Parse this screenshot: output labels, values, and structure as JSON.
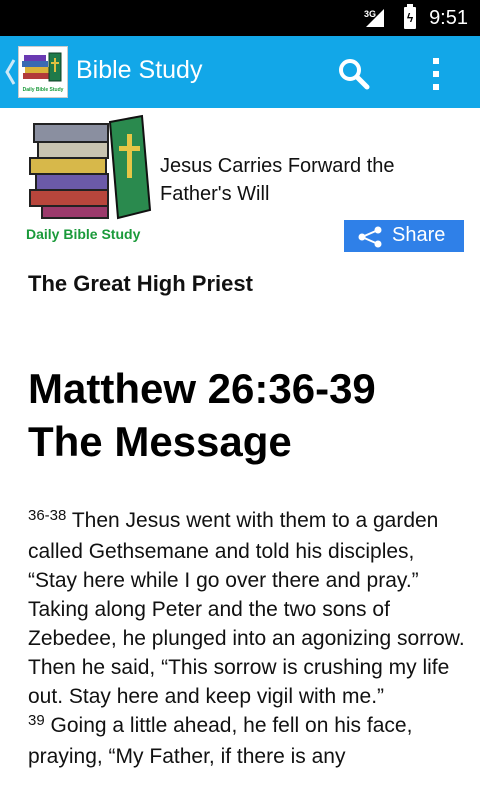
{
  "status_bar": {
    "network": "3G",
    "time": "9:51"
  },
  "app_bar": {
    "title": "Bible Study",
    "logo_text": "Daily Bible Study",
    "icons": [
      "up-chevron-icon",
      "search-icon",
      "overflow-menu-icon"
    ]
  },
  "devotion": {
    "title_line1": "Jesus Carries Forward the",
    "title_line2": "Father's Will",
    "site_name": "Daily Bible Study",
    "share_label": "Share",
    "subtitle": "The Great High Priest",
    "scripture_line1": "Matthew 26:36-39",
    "scripture_line2": "The Message",
    "verses": [
      {
        "number": "36-38",
        "text": " Then Jesus went with them to a garden called Gethsemane and told his disciples, “Stay here while I go over there and pray.” Taking along Peter and the two sons of Zebedee, he plunged into an agonizing sorrow. Then he said, “This sorrow is crushing my life out. Stay here and keep vigil with me.”"
      },
      {
        "number": "39",
        "text": " Going a little ahead, he fell on his face, praying, “My Father, if there is any"
      }
    ]
  },
  "colors": {
    "app_bar": "#12a7e8",
    "share_button": "#2f80e8",
    "site_name": "#1a9a3a",
    "status_bar": "#000000"
  }
}
